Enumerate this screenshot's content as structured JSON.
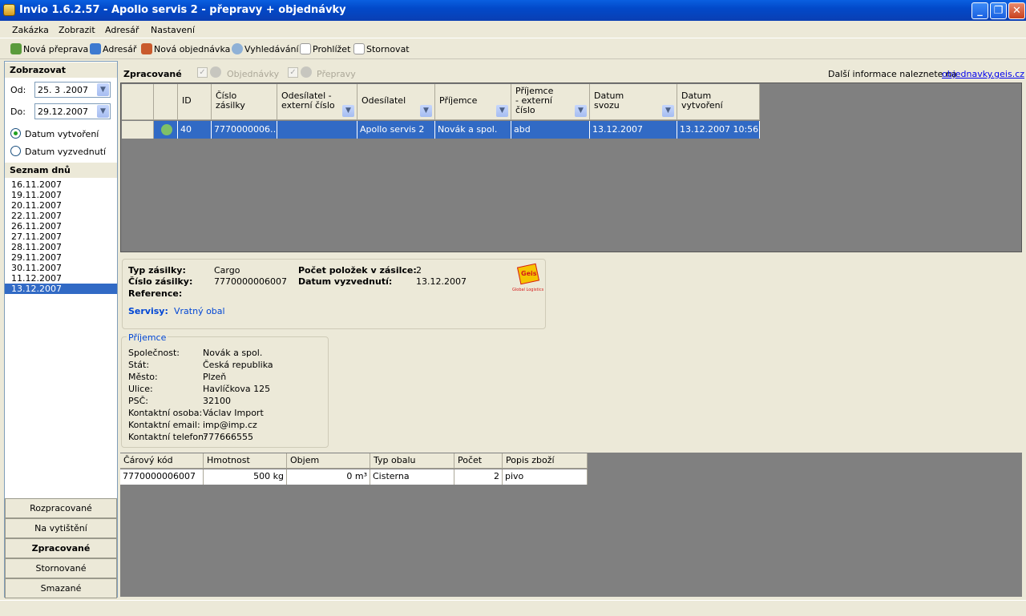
{
  "window": {
    "title": "Invio 1.6.2.57 - Apollo servis 2 - přepravy + objednávky"
  },
  "menu": [
    "Zakázka",
    "Zobrazit",
    "Adresář",
    "Nastavení"
  ],
  "toolbar": {
    "new_transport": "Nová přeprava",
    "address_book": "Adresář",
    "new_order": "Nová objednávka",
    "search": "Vyhledávání",
    "browse": "Prohlížet",
    "cancel": "Stornovat"
  },
  "left": {
    "display_heading": "Zobrazovat",
    "from_label": "Od:",
    "from_value": "25. 3 .2007",
    "to_label": "Do:",
    "to_value": "29.12.2007",
    "radio_created": "Datum vytvoření",
    "radio_pickup": "Datum vyzvednutí",
    "days_heading": "Seznam dnů",
    "days": [
      "16.11.2007",
      "19.11.2007",
      "20.11.2007",
      "22.11.2007",
      "26.11.2007",
      "27.11.2007",
      "28.11.2007",
      "29.11.2007",
      "30.11.2007",
      "11.12.2007",
      "13.12.2007"
    ],
    "selected_day": "13.12.2007",
    "nav": [
      "Rozpracované",
      "Na vytištění",
      "Zpracované",
      "Stornované",
      "Smazané"
    ],
    "active_nav": "Zpracované"
  },
  "main": {
    "section_title": "Zpracované",
    "filter_orders": "Objednávky",
    "filter_transports": "Přepravy",
    "info_text": "Další informace naleznete na",
    "info_link": "objednavky.geis.cz"
  },
  "grid": {
    "headers": [
      "ID",
      "Číslo\nzásilky",
      "Odesílatel -\nexterní číslo",
      "Odesílatel",
      "Příjemce",
      "Příjemce\n- externí\nčíslo",
      "Datum\nsvozu",
      "Datum\nvytvoření"
    ],
    "row": {
      "id": "40",
      "shipment_no": "7770000006…",
      "sender_ext": "",
      "sender": "Apollo servis 2",
      "recipient": "Novák a spol.",
      "recipient_ext": "abd",
      "pickup_date": "13.12.2007",
      "created": "13.12.2007 10:56"
    }
  },
  "details": {
    "type_label": "Typ zásilky:",
    "type_value": "Cargo",
    "number_label": "Číslo zásilky:",
    "number_value": "7770000006007",
    "reference_label": "Reference:",
    "count_label": "Počet položek v zásilce:",
    "count_value": "2",
    "pickup_label": "Datum vyzvednutí:",
    "pickup_value": "13.12.2007",
    "services_label": "Servisy:",
    "services_value": "Vratný obal",
    "logo_text": "Geis",
    "logo_sub": "Global Logistics"
  },
  "recipient": {
    "heading": "Příjemce",
    "company_label": "Společnost:",
    "company": "Novák a spol.",
    "country_label": "Stát:",
    "country": "Česká republika",
    "city_label": "Město:",
    "city": "Plzeň",
    "street_label": "Ulice:",
    "street": "Havlíčkova 125",
    "zip_label": "PSČ:",
    "zip": "32100",
    "contact_label": "Kontaktní osoba:",
    "contact": "Václav Import",
    "email_label": "Kontaktní email:",
    "email": "imp@imp.cz",
    "phone_label": "Kontaktní telefon:",
    "phone": "777666555"
  },
  "items": {
    "headers": [
      "Čárový kód",
      "Hmotnost",
      "Objem",
      "Typ obalu",
      "Počet",
      "Popis zboží"
    ],
    "row": {
      "barcode": "7770000006007",
      "weight": "500 kg",
      "volume": "0 m³",
      "package": "Cisterna",
      "count": "2",
      "description": "pivo"
    }
  },
  "colors": {
    "selection": "#316ac5",
    "titlebar": "#0a5fe0",
    "link": "#0000ee"
  }
}
